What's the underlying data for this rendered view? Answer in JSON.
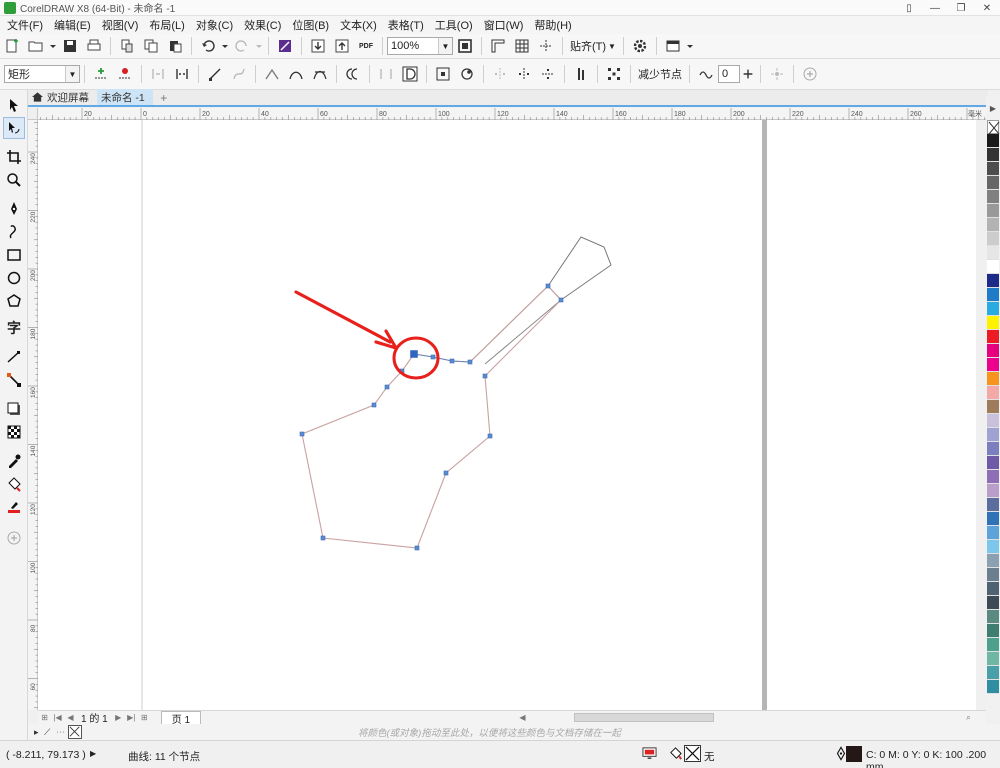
{
  "window": {
    "title": "CorelDRAW X8 (64-Bit) - 未命名 -1"
  },
  "menu": [
    "文件(F)",
    "编辑(E)",
    "视图(V)",
    "布局(L)",
    "对象(C)",
    "效果(C)",
    "位图(B)",
    "文本(X)",
    "表格(T)",
    "工具(O)",
    "窗口(W)",
    "帮助(H)"
  ],
  "toolbar": {
    "zoom_value": "100%",
    "snap_label": "贴齐(T)",
    "pdf_label": "PDF"
  },
  "property_bar": {
    "shape_select": "矩形",
    "reduce_nodes_label": "减少节点",
    "smoothing_value": "0"
  },
  "tabs": [
    {
      "label": "欢迎屏幕"
    },
    {
      "label": "未命名 -1"
    }
  ],
  "ruler": {
    "h_labels": [
      "20",
      "0",
      "20",
      "40",
      "60",
      "80",
      "100",
      "120",
      "140",
      "160",
      "180",
      "200",
      "220",
      "240",
      "260"
    ],
    "v_labels": [
      "240",
      "220",
      "200",
      "180",
      "160",
      "140",
      "120",
      "100",
      "80",
      "60"
    ],
    "unit": "毫米"
  },
  "page_nav": {
    "count": "1 的 1",
    "page_tab": "页 1"
  },
  "hint": "将颜色(或对象)拖动至此处，以便将这些颜色与文档存储在一起",
  "status": {
    "coords": "( -8.211, 79.173 )",
    "selection_info": "曲线: 11 个节点",
    "fill_none": "无",
    "color_info": "C: 0 M: 0 Y: 0 K: 100  .200 mm"
  },
  "palette_colors": [
    "#1a1a1a",
    "#333333",
    "#4d4d4d",
    "#666666",
    "#808080",
    "#999999",
    "#b3b3b3",
    "#cccccc",
    "#e6e6e6",
    "#ffffff",
    "#1e2a8a",
    "#1d7bc8",
    "#29aae1",
    "#fff200",
    "#ed1c24",
    "#e6007e",
    "#ec008c",
    "#f7941d",
    "#f4a8a8",
    "#9e7b5a",
    "#c9c1dc",
    "#a0a3d2",
    "#7b7fc0",
    "#6f5aa8",
    "#8e6fb6",
    "#b89ec9",
    "#5b6e9e",
    "#2f72b8",
    "#5ba3d9",
    "#7cc6ec",
    "#8ba1b2",
    "#6b7f8f",
    "#4f6272",
    "#3c4a55",
    "#5a8a80",
    "#3f7d70",
    "#4da08c",
    "#6fb6a3",
    "#4aa0a8",
    "#2f8fa0"
  ],
  "icons": [
    "select-icon",
    "shape-tool-icon",
    "crop-icon",
    "zoom-icon",
    "freehand-icon",
    "artistic-media-icon",
    "rectangle-icon",
    "ellipse-icon",
    "polygon-icon",
    "text-icon",
    "parallel-dimension-icon",
    "connector-icon",
    "drop-shadow-icon",
    "transparency-icon",
    "eyedropper-icon",
    "interactive-fill-icon",
    "smart-fill-icon",
    "add-icon"
  ]
}
